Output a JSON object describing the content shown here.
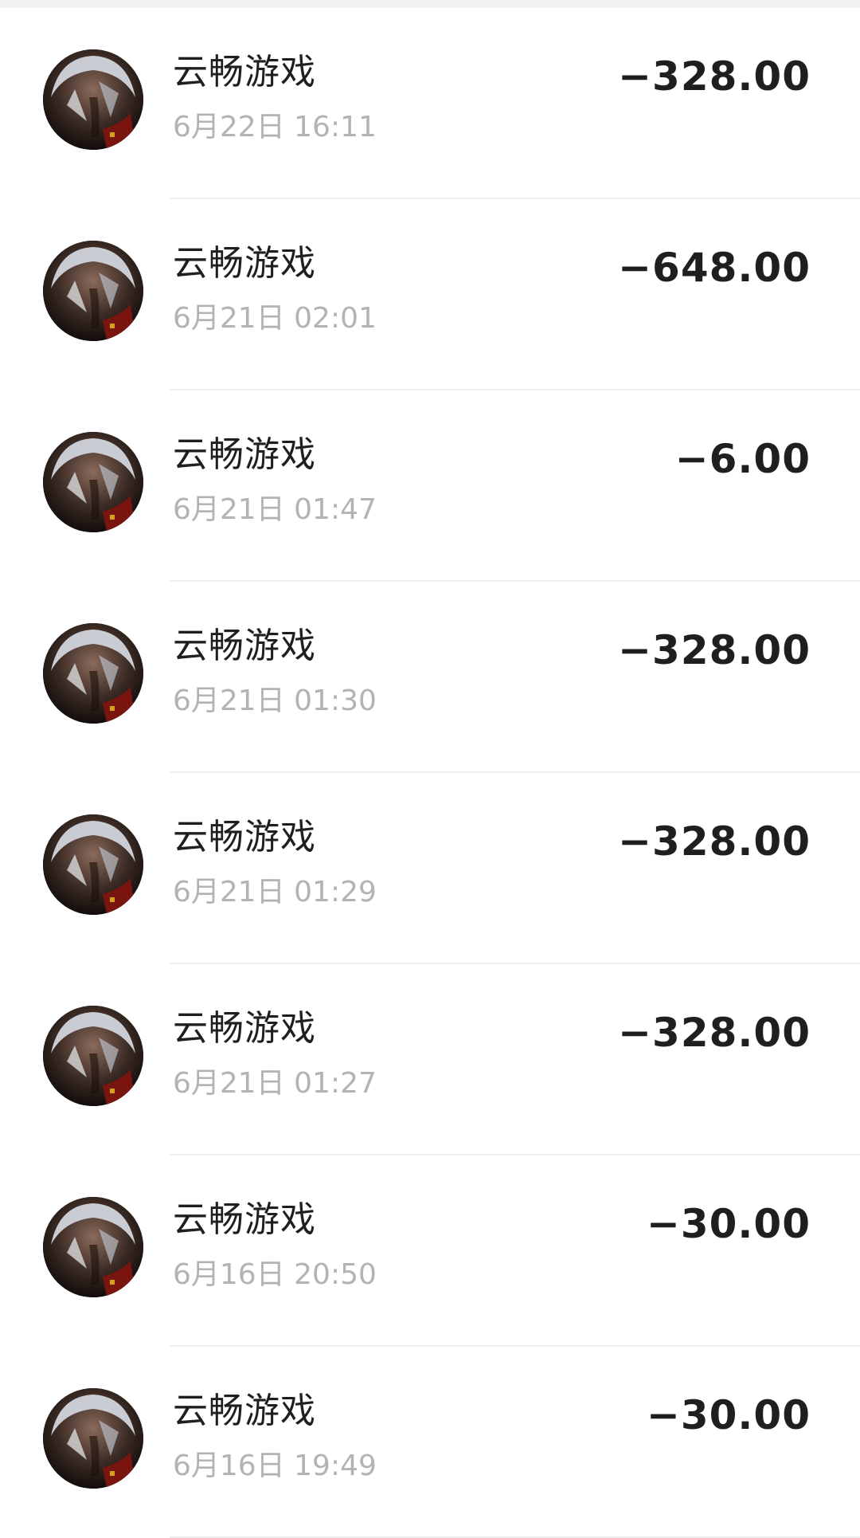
{
  "transactions": [
    {
      "merchant": "云畅游戏",
      "time": "6月22日 16:11",
      "amount": "−328.00"
    },
    {
      "merchant": "云畅游戏",
      "time": "6月21日 02:01",
      "amount": "−648.00"
    },
    {
      "merchant": "云畅游戏",
      "time": "6月21日 01:47",
      "amount": "−6.00"
    },
    {
      "merchant": "云畅游戏",
      "time": "6月21日 01:30",
      "amount": "−328.00"
    },
    {
      "merchant": "云畅游戏",
      "time": "6月21日 01:29",
      "amount": "−328.00"
    },
    {
      "merchant": "云畅游戏",
      "time": "6月21日 01:27",
      "amount": "−328.00"
    },
    {
      "merchant": "云畅游戏",
      "time": "6月16日 20:50",
      "amount": "−30.00"
    },
    {
      "merchant": "云畅游戏",
      "time": "6月16日 19:49",
      "amount": "−30.00"
    }
  ]
}
